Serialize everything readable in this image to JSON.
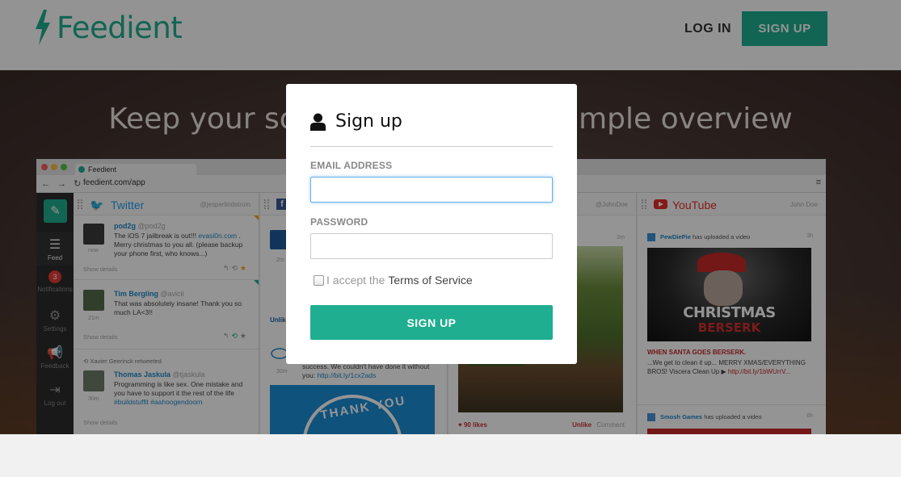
{
  "nav": {
    "brand": "Feedient",
    "login_label": "LOG IN",
    "signup_label": "SIGN UP"
  },
  "hero": {
    "headline": "Keep your social media in one simple overview"
  },
  "browser": {
    "tab_title": "Feedient",
    "url": "feedient.com/app",
    "sidebar": [
      {
        "label": "Feed",
        "icon": "list-icon"
      },
      {
        "label": "Notifications",
        "icon": "bell-icon",
        "badge": "3"
      },
      {
        "label": "Settings",
        "icon": "gear-icon"
      },
      {
        "label": "Feedback",
        "icon": "megaphone-icon"
      },
      {
        "label": "Log out",
        "icon": "logout-icon"
      }
    ],
    "twitter": {
      "title": "Twitter",
      "handle": "@jesperlindstrom",
      "posts": [
        {
          "author": "pod2g",
          "handle": "@pod2g",
          "text_a": "The iOS 7 jailbreak is out!!! ",
          "link": "evasi0n.com",
          "text_b": " . Merry christmas to you all. (please backup your phone first, who knows...)",
          "time": "now",
          "details": "Show details"
        },
        {
          "author": "Tim Bergling",
          "handle": "@avicii",
          "text_a": "That was absolutely insane! Thank you so much LA<3!!",
          "time": "21m",
          "details": "Show details"
        },
        {
          "retweet": "Xavier Geerinck retweeted",
          "author": "Thomas Jaskula",
          "handle": "@tjaskula",
          "text_a": "Programming is like sex. One mistake and you have to support it the rest of the life ",
          "tags": "#buildstuffit #aahoogendoorn",
          "time": "30m",
          "details": "Show details"
        }
      ]
    },
    "facebook": {
      "time": "2m",
      "unlike": "Unlike",
      "time2": "30m",
      "text_a": "success. We couldn't have done it without you: ",
      "link": "http://bit.ly/1cx2ads",
      "image_text": "THANK YOU"
    },
    "instagram": {
      "handle": "@JohnDoe",
      "time": "2m",
      "likes": "90 likes",
      "unlike": "Unlike",
      "comment": "Comment"
    },
    "youtube": {
      "title": "YouTube",
      "handle": "John Doe",
      "posts": [
        {
          "channel": "PewDiePie",
          "action": " has uploaded a video",
          "time": "3h",
          "thumb_title_a": "CHRISTMAS",
          "thumb_title_b": "BERSERK",
          "video_title": "WHEN SANTA GOES BERSERK.",
          "desc_a": "...We get to clean it up... MERRY XMAS/EVERYTHING BROS! Viscera Clean Up ▶ ",
          "link": "http://bit.ly/1bWUrrV..."
        },
        {
          "channel": "Smosh Games",
          "action": " has uploaded a video",
          "time": "6h"
        }
      ]
    }
  },
  "modal": {
    "title": "Sign up",
    "email_label": "EMAIL ADDRESS",
    "email_value": "",
    "password_label": "PASSWORD",
    "password_value": "",
    "terms_prefix": "I accept the",
    "terms_link": "Terms of Service",
    "terms_checked": false,
    "submit_label": "SIGN UP"
  },
  "colors": {
    "brand": "#1fae8f",
    "twitter": "#1da1f2",
    "youtube": "#e52d27",
    "facebook": "#3b5998"
  }
}
